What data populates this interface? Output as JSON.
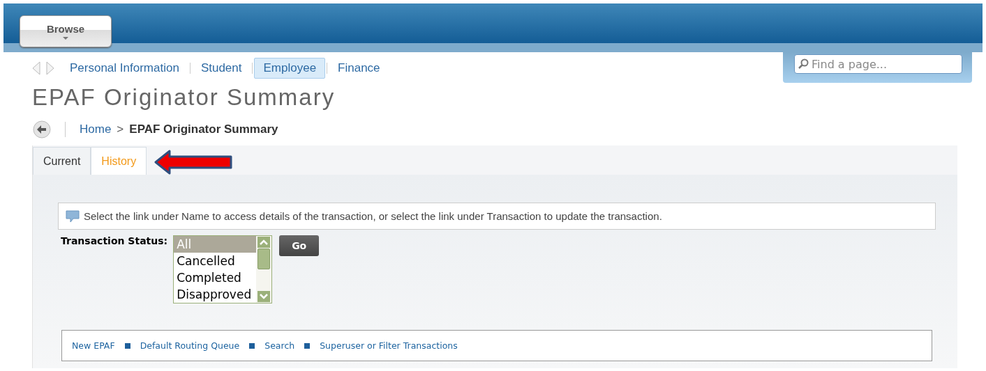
{
  "header": {
    "browse_button": "Browse"
  },
  "nav": {
    "items": [
      {
        "label": "Personal Information",
        "selected": false
      },
      {
        "label": "Student",
        "selected": false
      },
      {
        "label": "Employee",
        "selected": true
      },
      {
        "label": "Finance",
        "selected": false
      }
    ]
  },
  "search": {
    "placeholder": "Find a page..."
  },
  "page_title": "EPAF Originator Summary",
  "breadcrumb": {
    "home": "Home",
    "separator": ">",
    "current": "EPAF Originator Summary"
  },
  "tabs": [
    {
      "label": "Current",
      "selected": false
    },
    {
      "label": "History",
      "selected": true
    }
  ],
  "info_message": "Select the link under Name to access details of the transaction, or select the link under Transaction to update the transaction.",
  "status_filter": {
    "label": "Transaction Status:",
    "options": [
      {
        "label": "All",
        "selected": true
      },
      {
        "label": "Cancelled",
        "selected": false
      },
      {
        "label": "Completed",
        "selected": false
      },
      {
        "label": "Disapproved",
        "selected": false
      }
    ],
    "button": "Go"
  },
  "links": [
    "New EPAF",
    "Default Routing Queue",
    "Search",
    "Superuser or Filter Transactions"
  ]
}
